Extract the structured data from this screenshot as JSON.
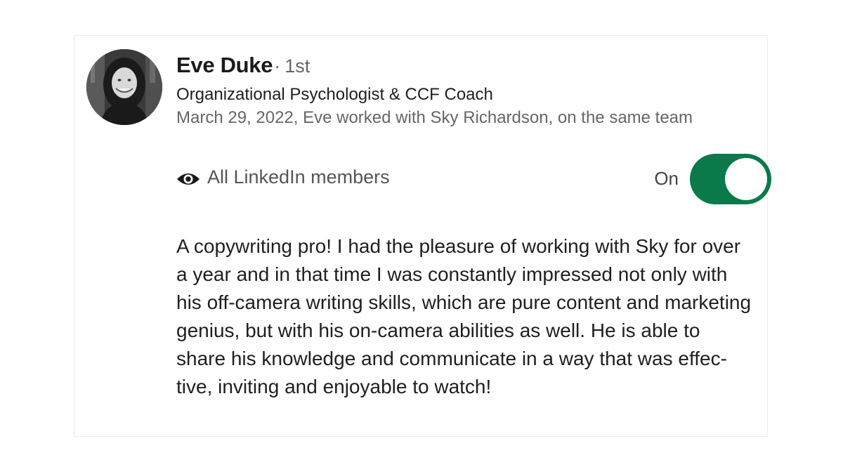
{
  "recommendation": {
    "author_name": "Eve Duke",
    "separator": "·",
    "connection_degree": "1st",
    "headline": "Organizational Psychologist & CCF Coach",
    "meta": "March 29, 2022, Eve worked with Sky Richardson, on the same team",
    "visibility": {
      "icon": "eye-icon",
      "label": "All LinkedIn members",
      "toggle_label": "On",
      "toggle_on": true
    },
    "text": "A copywriting pro! I had the pleasure of working with Sky for over a year and in that time I was constantly impressed not only with his off-camera writing skills, which are pure content and marketing genius, but with his on-camera abilities as well. He is able to share his knowledge and communicate in a way that was effec-tive, inviting and enjoyable to watch!"
  },
  "colors": {
    "toggle_on": "#0a7a4a",
    "name": "#1a1a1a",
    "secondary_text": "#666666"
  }
}
